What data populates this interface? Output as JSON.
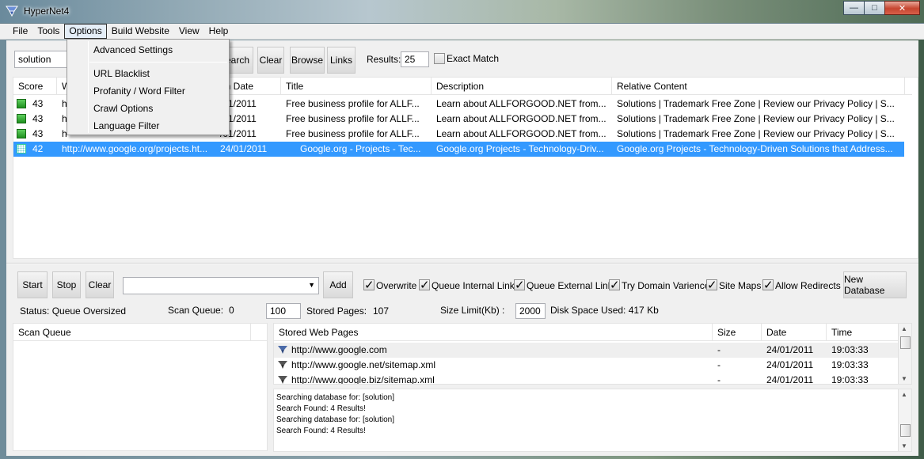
{
  "window": {
    "title": "HyperNet4"
  },
  "menubar": {
    "items": [
      "File",
      "Tools",
      "Options",
      "Build Website",
      "View",
      "Help"
    ]
  },
  "options_menu": {
    "items": [
      "Advanced Settings",
      "URL Blacklist",
      "Profanity / Word Filter",
      "Crawl Options",
      "Language Filter"
    ]
  },
  "search": {
    "query": "solution",
    "buttons": [
      "earch",
      "Clear",
      "Browse",
      "Links"
    ],
    "results_label": "Results:",
    "results_value": "25",
    "exact_match_label": "Exact Match"
  },
  "results_table": {
    "columns": [
      "Score",
      "W",
      "an Date",
      "Title",
      "Description",
      "Relative Content"
    ],
    "rows": [
      {
        "score": "43",
        "url": "h",
        "date": "/01/2011",
        "title": "Free business profile for ALLF...",
        "description": "Learn about ALLFORGOOD.NET from...",
        "content": "Solutions | Trademark Free Zone | Review our Privacy Policy | S..."
      },
      {
        "score": "43",
        "url": "h",
        "date": "/01/2011",
        "title": "Free business profile for ALLF...",
        "description": "Learn about ALLFORGOOD.NET from...",
        "content": "Solutions | Trademark Free Zone | Review our Privacy Policy | S..."
      },
      {
        "score": "43",
        "url": "h",
        "date": "/01/2011",
        "title": "Free business profile for ALLF...",
        "description": "Learn about ALLFORGOOD.NET from...",
        "content": "Solutions | Trademark Free Zone | Review our Privacy Policy | S..."
      },
      {
        "score": "42",
        "url": "http://www.google.org/projects.ht...",
        "date": "24/01/2011",
        "title": "Google.org - Projects - Tec...",
        "description": "Google.org Projects - Technology-Driv...",
        "content": "Google.org Projects - Technology-Driven Solutions that Address..."
      }
    ]
  },
  "crawl": {
    "buttons": [
      "Start",
      "Stop",
      "Clear"
    ],
    "add_label": "Add",
    "options": [
      {
        "label": "Overwrite",
        "checked": true
      },
      {
        "label": "Queue Internal Links",
        "checked": true
      },
      {
        "label": "Queue External Links",
        "checked": true
      },
      {
        "label": "Try Domain Variences",
        "checked": true
      },
      {
        "label": "Site Maps",
        "checked": true
      },
      {
        "label": "Allow Redirects",
        "checked": true
      }
    ],
    "new_database_label": "New Database"
  },
  "status": {
    "status_text": "Status: Queue Oversized",
    "scan_queue_label": "Scan Queue:",
    "scan_queue_value": "0",
    "queue_limit": "100",
    "stored_pages_label": "Stored Pages:",
    "stored_pages_value": "107",
    "size_limit_label": "Size Limit(Kb) :",
    "size_limit_value": "2000",
    "disk_space_text": "Disk Space Used: 417 Kb"
  },
  "scan_queue_header": "Scan Queue",
  "stored_table": {
    "columns": [
      "Stored Web Pages",
      "Size",
      "Date",
      "Time"
    ],
    "rows": [
      {
        "url": "http://www.google.com",
        "size": "-",
        "date": "24/01/2011",
        "time": "19:03:33"
      },
      {
        "url": "http://www.google.net/sitemap.xml",
        "size": "-",
        "date": "24/01/2011",
        "time": "19:03:33"
      },
      {
        "url": "http://www.google.biz/sitemap.xml",
        "size": "-",
        "date": "24/01/2011",
        "time": "19:03:33"
      }
    ]
  },
  "log": [
    "Searching database for: [solution]",
    "Search Found: 4 Results!",
    "Searching database for: [solution]",
    "Search Found: 4 Results!"
  ],
  "colors": {
    "selection": "#3399ff",
    "score_icon": "#2ca02c"
  }
}
